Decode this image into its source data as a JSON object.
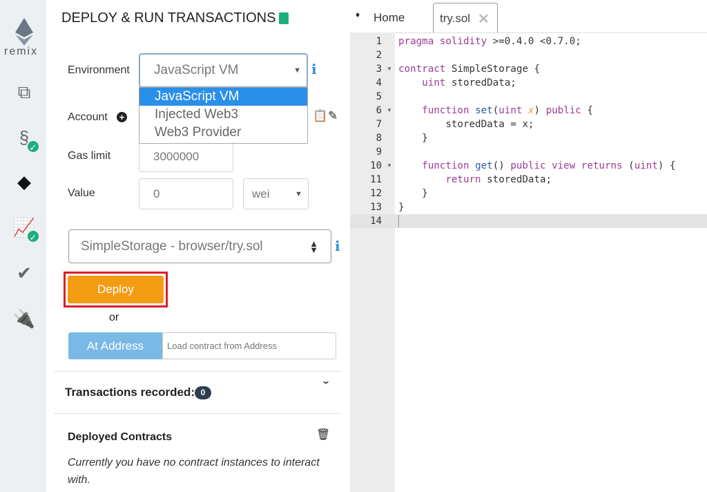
{
  "sidebar": {
    "logo_text": "remix",
    "icons": [
      "file-explorer-icon",
      "solidity-compiler-icon",
      "deploy-run-icon",
      "analysis-icon",
      "testing-icon",
      "plugin-manager-icon"
    ]
  },
  "panel": {
    "title": "DEPLOY & RUN TRANSACTIONS",
    "environment": {
      "label": "Environment",
      "value": "JavaScript VM",
      "options": [
        "JavaScript VM",
        "Injected Web3",
        "Web3 Provider"
      ],
      "selected_option_color": "#2a8fe8"
    },
    "account": {
      "label": "Account"
    },
    "gas_limit": {
      "label": "Gas limit",
      "value": "3000000"
    },
    "value": {
      "label": "Value",
      "amount": "0",
      "unit": "wei"
    },
    "contract": {
      "value": "SimpleStorage - browser/try.sol"
    },
    "deploy_label": "Deploy",
    "deploy_color": "#f39c12",
    "or_label": "or",
    "at_address_label": "At Address",
    "at_address_placeholder": "Load contract from Address",
    "transactions_label": "Transactions recorded:",
    "transactions_count": "0",
    "deployed_title": "Deployed Contracts",
    "deployed_empty": "Currently you have no contract instances to interact with."
  },
  "tabs": [
    {
      "label": "Home"
    },
    {
      "label": "try.sol",
      "active": true
    }
  ],
  "code": [
    [
      [
        "pragma solidity",
        "kw"
      ],
      [
        " >=0.4.0 <0.7.0;",
        ""
      ]
    ],
    [],
    [
      [
        "contract",
        "kw"
      ],
      [
        " SimpleStorage {",
        ""
      ]
    ],
    [
      [
        "    ",
        ""
      ],
      [
        "uint",
        "kw"
      ],
      [
        " storedData;",
        ""
      ]
    ],
    [],
    [
      [
        "    ",
        ""
      ],
      [
        "function",
        "kw"
      ],
      [
        " ",
        ""
      ],
      [
        "set",
        "fn"
      ],
      [
        "(",
        ""
      ],
      [
        "uint",
        "kw"
      ],
      [
        " ",
        ""
      ],
      [
        "x",
        "var"
      ],
      [
        ") ",
        ""
      ],
      [
        "public",
        "kw"
      ],
      [
        " {",
        ""
      ]
    ],
    [
      [
        "        storedData = x;",
        ""
      ]
    ],
    [
      [
        "    }",
        ""
      ]
    ],
    [],
    [
      [
        "    ",
        ""
      ],
      [
        "function",
        "kw"
      ],
      [
        " ",
        ""
      ],
      [
        "get",
        "fn"
      ],
      [
        "() ",
        ""
      ],
      [
        "public view returns",
        "kw"
      ],
      [
        " (",
        ""
      ],
      [
        "uint",
        "kw"
      ],
      [
        ") {",
        ""
      ]
    ],
    [
      [
        "        ",
        ""
      ],
      [
        "return",
        "kw"
      ],
      [
        " storedData;",
        ""
      ]
    ],
    [
      [
        "    }",
        ""
      ]
    ],
    [
      [
        "}",
        ""
      ]
    ],
    []
  ],
  "fold_lines": [
    3,
    6,
    10
  ],
  "active_line": 14
}
